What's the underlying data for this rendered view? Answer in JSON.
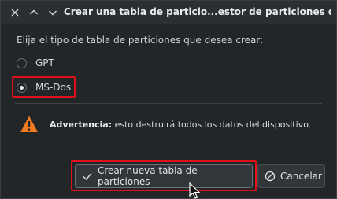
{
  "window": {
    "title": "Crear una tabla de particio...estor de particiones de KDE"
  },
  "titlebar": {
    "close_icon": "close-icon",
    "maximize_icon": "chevron-up-icon",
    "minimize_icon": "chevron-down-icon"
  },
  "dialog": {
    "prompt": "Elija el tipo de tabla de particiones que desea crear:",
    "options": [
      {
        "label": "GPT",
        "selected": false
      },
      {
        "label": "MS-Dos",
        "selected": true
      }
    ],
    "warning_title": "Advertencia:",
    "warning_text": " esto destruirá todos los datos del dispositivo.",
    "warning_icon": "warning-icon"
  },
  "buttons": {
    "create_label": "Crear nueva tabla de particiones",
    "create_icon": "checkmark-icon",
    "cancel_label": "Cancelar",
    "cancel_icon": "cancel-icon"
  },
  "colors": {
    "highlight": "#e0101a",
    "warning": "#f47b20"
  }
}
